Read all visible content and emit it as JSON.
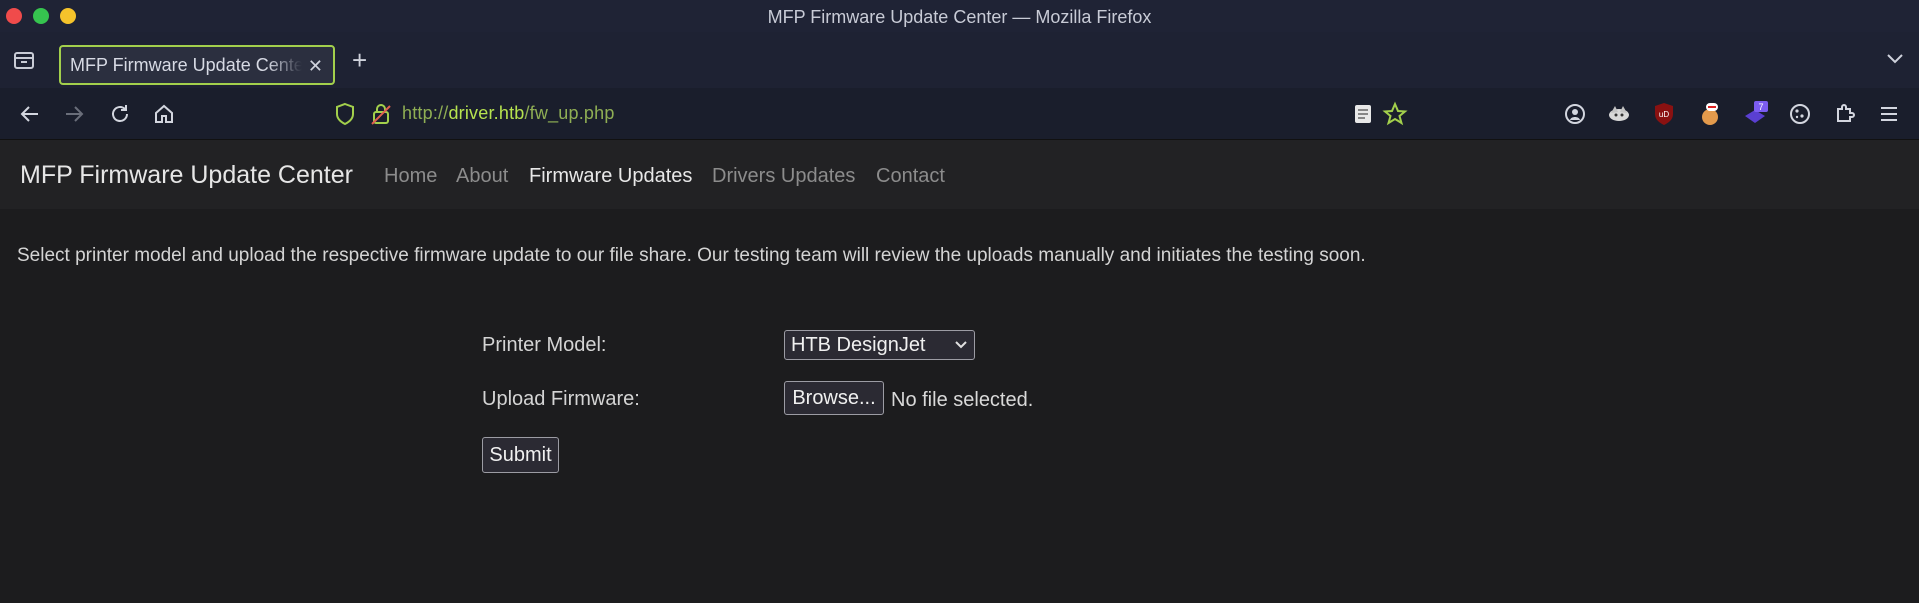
{
  "window": {
    "title": "MFP Firmware Update Center — Mozilla Firefox"
  },
  "tabs": [
    {
      "title": "MFP Firmware Update Center"
    }
  ],
  "urlbar": {
    "scheme": "http://",
    "host": "driver.htb",
    "path": "/fw_up.php"
  },
  "extensions": {
    "badge_count": "7"
  },
  "site": {
    "brand": "MFP Firmware Update Center",
    "nav": [
      "Home",
      "About",
      "Firmware Updates",
      "Drivers Updates",
      "Contact"
    ],
    "active_nav": "Firmware Updates"
  },
  "content": {
    "intro": "Select printer model and upload the respective firmware update to our file share. Our testing team will review the uploads manually and initiates the testing soon.",
    "printer_model_label": "Printer Model:",
    "printer_model_value": "HTB DesignJet",
    "upload_label": "Upload Firmware:",
    "browse_label": "Browse...",
    "file_status": "No file selected.",
    "submit_label": "Submit"
  },
  "colors": {
    "accent": "#a3d04c",
    "url_host": "#b6e34f",
    "page_bg": "#1c1c1e",
    "nav_bg": "#222224"
  }
}
